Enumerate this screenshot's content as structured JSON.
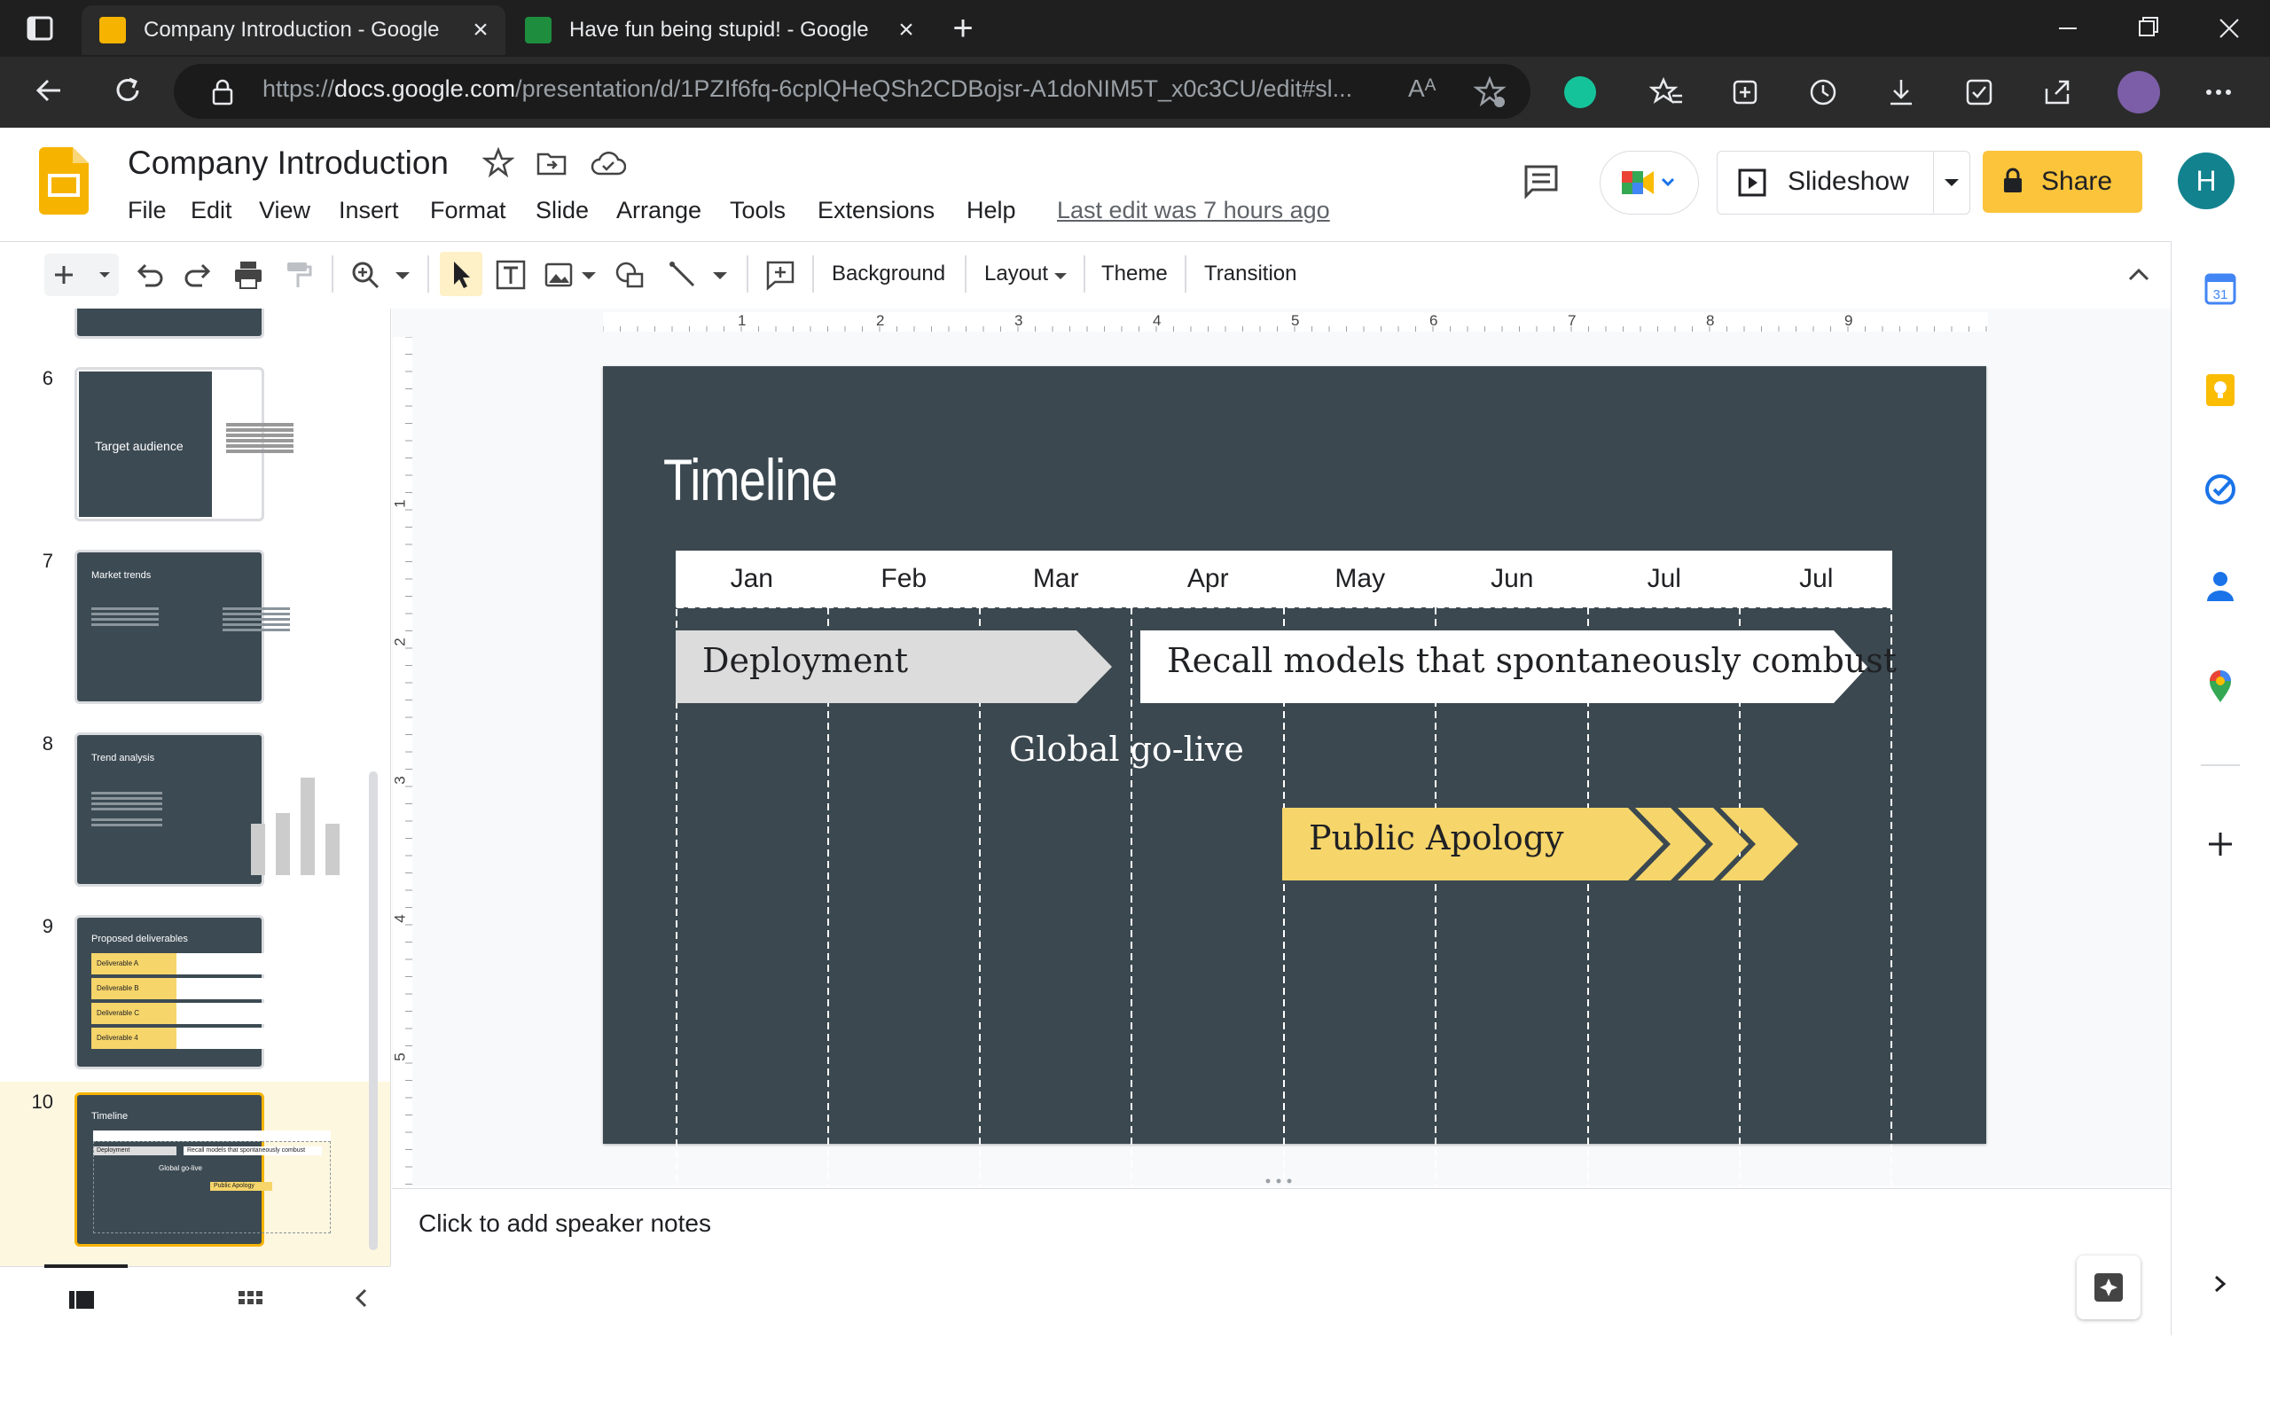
{
  "browser": {
    "tabs": [
      {
        "title": "Company Introduction - Google",
        "active": true
      },
      {
        "title": "Have fun being stupid! - Google",
        "active": false
      }
    ],
    "url_prefix": "https://",
    "url_domain": "docs.google.com",
    "url_path": "/presentation/d/1PZIf6fq-6cplQHeQSh2CDBojsr-A1doNIM5T_x0c3CU/edit#sl...",
    "reader_mode_label": "Aᴬ"
  },
  "doc": {
    "title": "Company Introduction",
    "menu": [
      "File",
      "Edit",
      "View",
      "Insert",
      "Format",
      "Slide",
      "Arrange",
      "Tools",
      "Extensions",
      "Help"
    ],
    "last_edit": "Last edit was 7 hours ago",
    "slideshow_label": "Slideshow",
    "share_label": "Share",
    "avatar_initial": "H"
  },
  "toolbar": {
    "background": "Background",
    "layout": "Layout",
    "theme": "Theme",
    "transition": "Transition"
  },
  "ruler": {
    "h_labels": [
      "1",
      "2",
      "3",
      "4",
      "5",
      "6",
      "7",
      "8",
      "9"
    ],
    "v_labels": [
      "1",
      "2",
      "3",
      "4",
      "5"
    ]
  },
  "filmstrip": {
    "slides": [
      {
        "number": "6",
        "title": "Target audience",
        "selected": false
      },
      {
        "number": "7",
        "title": "Market trends",
        "selected": false
      },
      {
        "number": "8",
        "title": "Trend analysis",
        "selected": false
      },
      {
        "number": "9",
        "title": "Proposed deliverables",
        "selected": false
      },
      {
        "number": "10",
        "title": "Timeline",
        "selected": true
      }
    ],
    "slide9_items": [
      "Deliverable A",
      "Deliverable B",
      "Deliverable C",
      "Deliverable 4"
    ],
    "slide10_mini": {
      "deploy": "Deployment",
      "recall": "Recall models that spontaneously combust",
      "golive": "Global go-live",
      "apology": "Public Apology"
    }
  },
  "slide": {
    "title": "Timeline",
    "months": [
      "Jan",
      "Feb",
      "Mar",
      "Apr",
      "May",
      "Jun",
      "Jul",
      "Jul"
    ],
    "deployment": "Deployment",
    "recall": "Recall models that spontaneously combust",
    "golive": "Global go-live",
    "apology": "Public Apology"
  },
  "notes": {
    "placeholder": "Click to add speaker notes"
  },
  "colors": {
    "slide_bg": "#3b4850",
    "accent_yellow": "#f6d56a",
    "deploy_gray": "#dcdcdc",
    "share_yellow": "#fbc43b"
  }
}
